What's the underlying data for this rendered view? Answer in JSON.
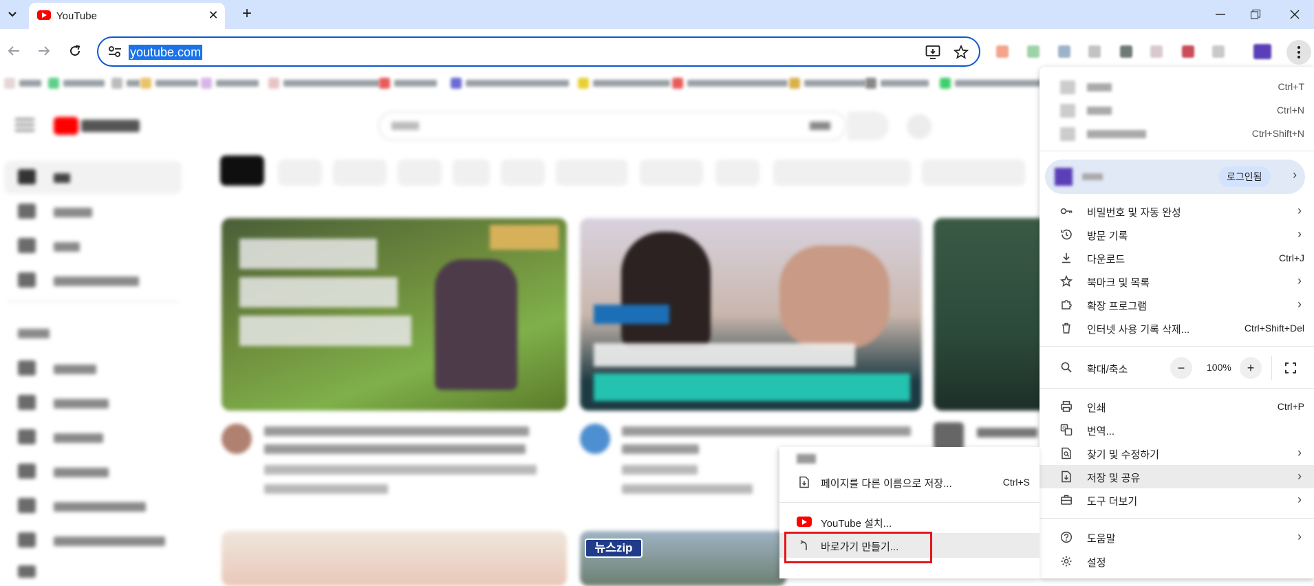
{
  "tab": {
    "title": "YouTube"
  },
  "omnibox": {
    "url": "youtube.com"
  },
  "menu": {
    "top_items": [
      {
        "shortcut": "Ctrl+T"
      },
      {
        "shortcut": "Ctrl+N"
      },
      {
        "shortcut": "Ctrl+Shift+N"
      }
    ],
    "profile": {
      "badge": "로그인됨"
    },
    "items_a": [
      {
        "label": "비밀번호 및 자동 완성",
        "shortcut": "",
        "icon": "key-icon",
        "arrow": true
      },
      {
        "label": "방문 기록",
        "shortcut": "",
        "icon": "history-icon",
        "arrow": true
      },
      {
        "label": "다운로드",
        "shortcut": "Ctrl+J",
        "icon": "download-icon",
        "arrow": false
      },
      {
        "label": "북마크 및 목록",
        "shortcut": "",
        "icon": "star-icon",
        "arrow": true
      },
      {
        "label": "확장 프로그램",
        "shortcut": "",
        "icon": "puzzle-icon",
        "arrow": true
      },
      {
        "label": "인터넷 사용 기록 삭제...",
        "shortcut": "Ctrl+Shift+Del",
        "icon": "trash-icon",
        "arrow": false
      }
    ],
    "zoom": {
      "label": "확대/축소",
      "minus": "−",
      "value": "100%",
      "plus": "+"
    },
    "items_b": [
      {
        "label": "인쇄",
        "shortcut": "Ctrl+P",
        "icon": "print-icon",
        "arrow": false
      },
      {
        "label": "번역...",
        "shortcut": "",
        "icon": "translate-icon",
        "arrow": false
      },
      {
        "label": "찾기 및 수정하기",
        "shortcut": "",
        "icon": "find-icon",
        "arrow": true
      },
      {
        "label": "저장 및 공유",
        "shortcut": "",
        "icon": "save-share-icon",
        "arrow": true
      },
      {
        "label": "도구 더보기",
        "shortcut": "",
        "icon": "toolbox-icon",
        "arrow": true
      }
    ],
    "items_c": [
      {
        "label": "도움말",
        "icon": "help-icon",
        "arrow": true
      },
      {
        "label": "설정",
        "icon": "settings-icon",
        "arrow": false
      }
    ]
  },
  "submenu": {
    "save_page": {
      "label": "페이지를 다른 이름으로 저장...",
      "shortcut": "Ctrl+S"
    },
    "install": {
      "label": "YouTube 설치..."
    },
    "shortcut": {
      "label": "바로가기 만들기..."
    }
  },
  "colors": {
    "accent": "#0b57d0",
    "tabstrip": "#d3e3fd",
    "highlight_box": "#e8141b",
    "youtube_red": "#ff0000"
  }
}
